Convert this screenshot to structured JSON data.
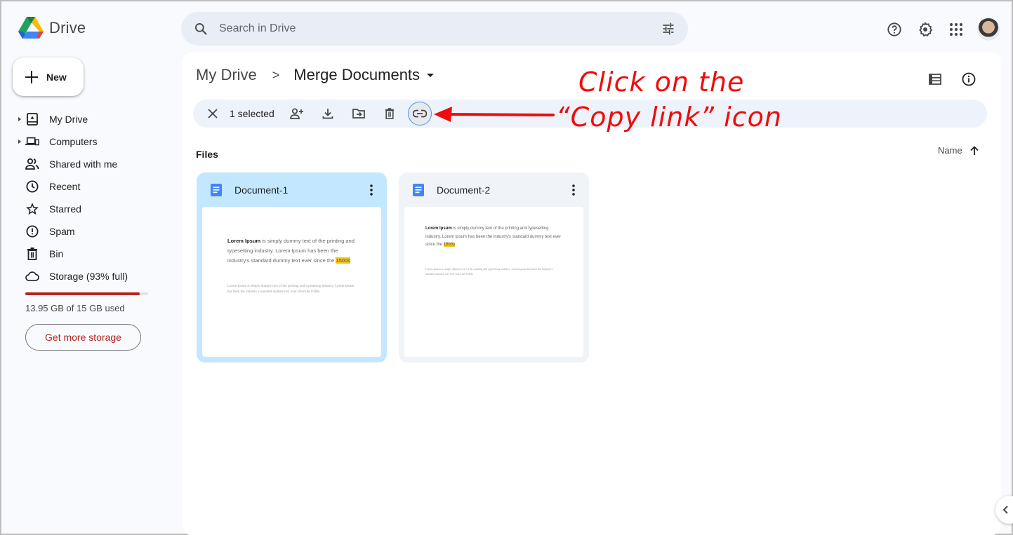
{
  "app": {
    "name": "Drive",
    "search_placeholder": "Search in Drive"
  },
  "header_icons": [
    "help-icon",
    "settings-icon",
    "apps-grid-icon",
    "account-avatar"
  ],
  "sidebar": {
    "new_label": "New",
    "items": [
      {
        "label": "My Drive",
        "icon": "my-drive-icon",
        "expandable": true
      },
      {
        "label": "Computers",
        "icon": "computers-icon",
        "expandable": true
      },
      {
        "label": "Shared with me",
        "icon": "shared-icon",
        "expandable": false
      },
      {
        "label": "Recent",
        "icon": "clock-icon",
        "expandable": false
      },
      {
        "label": "Starred",
        "icon": "star-icon",
        "expandable": false
      },
      {
        "label": "Spam",
        "icon": "spam-icon",
        "expandable": false
      },
      {
        "label": "Bin",
        "icon": "trash-icon",
        "expandable": false
      },
      {
        "label": "Storage (93% full)",
        "icon": "cloud-icon",
        "expandable": false
      }
    ],
    "storage": {
      "used_fraction": 0.93,
      "text": "13.95 GB of 15 GB used",
      "bar_color": "#b3261e"
    },
    "get_more_storage_label": "Get more storage"
  },
  "breadcrumb": {
    "root": "My Drive",
    "separator": ">",
    "current": "Merge Documents"
  },
  "selection_bar": {
    "count_label": "1 selected",
    "actions": [
      "close",
      "share",
      "download",
      "move",
      "delete",
      "copy-link"
    ],
    "active_action": "copy-link"
  },
  "files_section": {
    "label": "Files",
    "sort_label": "Name",
    "sort_direction": "ascending"
  },
  "files": [
    {
      "name": "Document-1",
      "selected": true,
      "preview": {
        "bold": "Lorem Ipsum",
        "text": " is simply dummy text of the printing and typesetting industry. Lorem Ipsum has been the industry's standard dummy text ever since the ",
        "highlight": "1500s",
        "small": "Lorem Ipsum is simply dummy text of the printing and typesetting industry. Lorem Ipsum has been the industry's standard dummy text ever since the 1500s."
      }
    },
    {
      "name": "Document-2",
      "selected": false,
      "preview": {
        "bold": "Lorem Ipsum",
        "text": " is simply dummy text of the printing and typesetting industry. Lorem Ipsum has been the industry's standard dummy text ever since the ",
        "highlight": "1500s",
        "small": "Lorem Ipsum is simply dummy text of the printing and typesetting industry. Lorem Ipsum has been the industry's standard dummy text ever since the 1500s."
      }
    }
  ],
  "annotation": {
    "line1": "Click on the",
    "line2": "“Copy link” icon",
    "color": "#ef0c0c"
  }
}
